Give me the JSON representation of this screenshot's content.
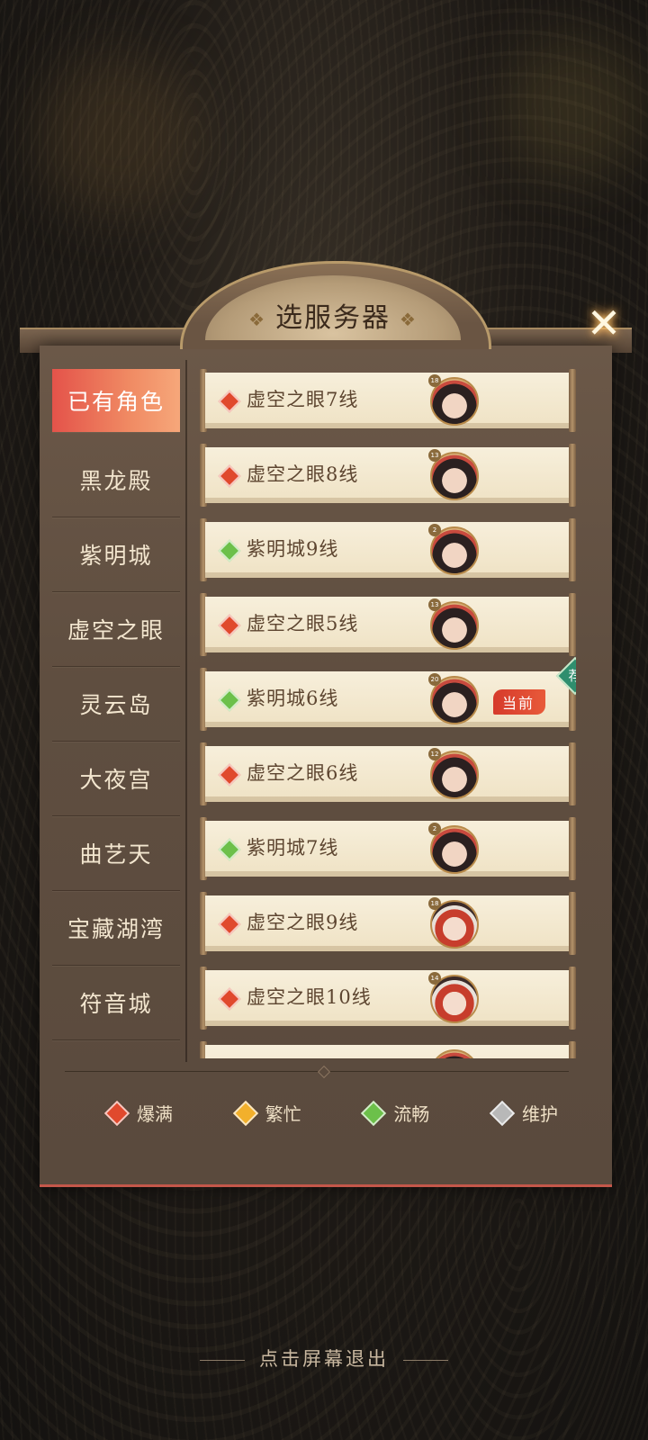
{
  "header": {
    "title": "选服务器",
    "close_icon": "close-x-icon"
  },
  "sidebar": {
    "items": [
      {
        "label": "已有角色",
        "active": true
      },
      {
        "label": "黑龙殿"
      },
      {
        "label": "紫明城"
      },
      {
        "label": "虚空之眼"
      },
      {
        "label": "灵云岛"
      },
      {
        "label": "大夜宫"
      },
      {
        "label": "曲艺天"
      },
      {
        "label": "宝藏湖湾"
      },
      {
        "label": "符音城"
      }
    ]
  },
  "servers": [
    {
      "name": "虚空之眼7线",
      "status": "red",
      "level": "18"
    },
    {
      "name": "虚空之眼8线",
      "status": "red",
      "level": "13"
    },
    {
      "name": "紫明城9线",
      "status": "green",
      "level": "2"
    },
    {
      "name": "虚空之眼5线",
      "status": "red",
      "level": "13"
    },
    {
      "name": "紫明城6线",
      "status": "green",
      "level": "20",
      "current_label": "当前",
      "recommend_label": "荐"
    },
    {
      "name": "虚空之眼6线",
      "status": "red",
      "level": "12"
    },
    {
      "name": "紫明城7线",
      "status": "green",
      "level": "2"
    },
    {
      "name": "虚空之眼9线",
      "status": "red",
      "level": "18"
    },
    {
      "name": "虚空之眼10线",
      "status": "red",
      "level": "14"
    }
  ],
  "legend": [
    {
      "label": "爆满",
      "color": "#e0492d"
    },
    {
      "label": "繁忙",
      "color": "#f2b02c"
    },
    {
      "label": "流畅",
      "color": "#6cc04a"
    },
    {
      "label": "维护",
      "color": "#b8b8b8"
    }
  ],
  "footer": {
    "exit_hint": "点击屏幕退出"
  }
}
